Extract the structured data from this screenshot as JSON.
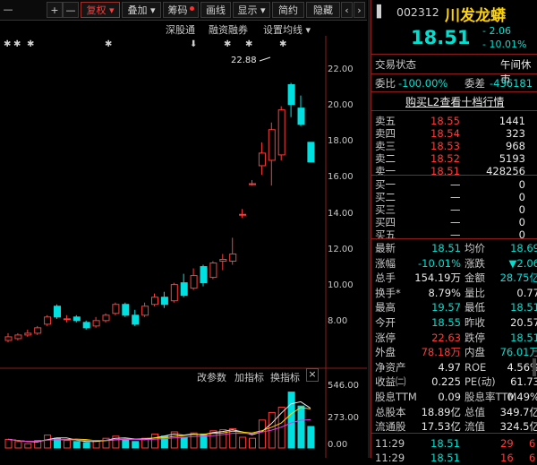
{
  "toolbar": {
    "items": [
      {
        "label": "—"
      },
      {
        "label": "+"
      },
      {
        "label": "—"
      },
      {
        "label": "复权 ▾"
      },
      {
        "label": "叠加 ▾"
      },
      {
        "label": "筹码"
      },
      {
        "label": "画线"
      },
      {
        "label": "显示 ▾"
      },
      {
        "label": "简约"
      },
      {
        "label": "隐藏"
      },
      {
        "label": "‹"
      },
      {
        "label": "›"
      }
    ]
  },
  "chart": {
    "top_menu": [
      "深股通",
      "融资融券",
      "设置均线 ▾"
    ],
    "high_label": "22.88",
    "y_labels": [
      "22.00",
      "20.00",
      "18.00",
      "16.00",
      "14.00",
      "12.00",
      "10.00",
      "8.00"
    ],
    "sub_menu": [
      "改参数",
      "加指标",
      "换指标"
    ],
    "vol_labels": [
      "546.00",
      "273.00",
      "0.00"
    ],
    "sub_close": "×",
    "colors": {
      "up": "#ff3b3b",
      "down": "#00e0e0",
      "ma1": "#e8e8e8",
      "ma2": "#ffd400",
      "ma3": "#e040e0"
    }
  },
  "quote": {
    "code": "002312",
    "name": "川发龙蟒",
    "price": "18.51",
    "change": "- 2.06",
    "change_pct": "- 10.01%",
    "status_label": "交易状态",
    "status_value": "午间休市",
    "wb_label": "委比",
    "wb_value": "-100.00%",
    "wc_label": "委差",
    "wc_value": "-436181",
    "l2_link": "购买L2查看十档行情"
  },
  "order_book": {
    "asks": [
      {
        "label": "卖五",
        "price": "18.55",
        "vol": "1441"
      },
      {
        "label": "卖四",
        "price": "18.54",
        "vol": "323"
      },
      {
        "label": "卖三",
        "price": "18.53",
        "vol": "968"
      },
      {
        "label": "卖二",
        "price": "18.52",
        "vol": "5193"
      },
      {
        "label": "卖一",
        "price": "18.51",
        "vol": "428256"
      }
    ],
    "bids": [
      {
        "label": "买一",
        "price": "—",
        "vol": "0"
      },
      {
        "label": "买二",
        "price": "—",
        "vol": "0"
      },
      {
        "label": "买三",
        "price": "—",
        "vol": "0"
      },
      {
        "label": "买四",
        "price": "—",
        "vol": "0"
      },
      {
        "label": "买五",
        "price": "—",
        "vol": "0"
      }
    ]
  },
  "stats": [
    {
      "l1": "最新",
      "v1": "18.51",
      "c1": "green",
      "l2": "均价",
      "v2": "18.69",
      "c2": "green"
    },
    {
      "l1": "涨幅",
      "v1": "-10.01%",
      "c1": "green",
      "l2": "涨跌",
      "v2": "▼2.06",
      "c2": "green"
    },
    {
      "l1": "总手",
      "v1": "154.19万",
      "c1": "white",
      "l2": "金额",
      "v2": "28.75亿",
      "c2": "cyan"
    },
    {
      "l1": "换手*",
      "v1": "8.79%",
      "c1": "white",
      "l2": "量比",
      "v2": "0.77",
      "c2": "white"
    },
    {
      "l1": "最高",
      "v1": "19.57",
      "c1": "green",
      "l2": "最低",
      "v2": "18.51",
      "c2": "green"
    },
    {
      "l1": "今开",
      "v1": "18.55",
      "c1": "green",
      "l2": "昨收",
      "v2": "20.57",
      "c2": "white"
    },
    {
      "l1": "涨停",
      "v1": "22.63",
      "c1": "red",
      "l2": "跌停",
      "v2": "18.51",
      "c2": "green"
    },
    {
      "l1": "外盘",
      "v1": "78.18万",
      "c1": "red",
      "l2": "内盘",
      "v2": "76.01万",
      "c2": "green"
    },
    {
      "l1": "净资产",
      "v1": "4.97",
      "c1": "white",
      "l2": "ROE",
      "v2": "4.56%",
      "c2": "white"
    },
    {
      "l1": "收益㈡",
      "v1": "0.225",
      "c1": "white",
      "l2": "PE(动)",
      "v2": "61.73",
      "c2": "white"
    },
    {
      "l1": "股息TTM",
      "v1": "0.09",
      "c1": "white",
      "l2": "股息率TTM",
      "v2": "0.49%",
      "c2": "white"
    },
    {
      "l1": "总股本",
      "v1": "18.89亿",
      "c1": "white",
      "l2": "总值",
      "v2": "349.7亿",
      "c2": "white"
    },
    {
      "l1": "流通股",
      "v1": "17.53亿",
      "c1": "white",
      "l2": "流值",
      "v2": "324.5亿",
      "c2": "white"
    }
  ],
  "ticks": [
    {
      "time": "11:29",
      "price": "18.51",
      "vol": "29",
      "extra": "6"
    },
    {
      "time": "11:29",
      "price": "18.51",
      "vol": "16",
      "extra": "6"
    }
  ]
}
